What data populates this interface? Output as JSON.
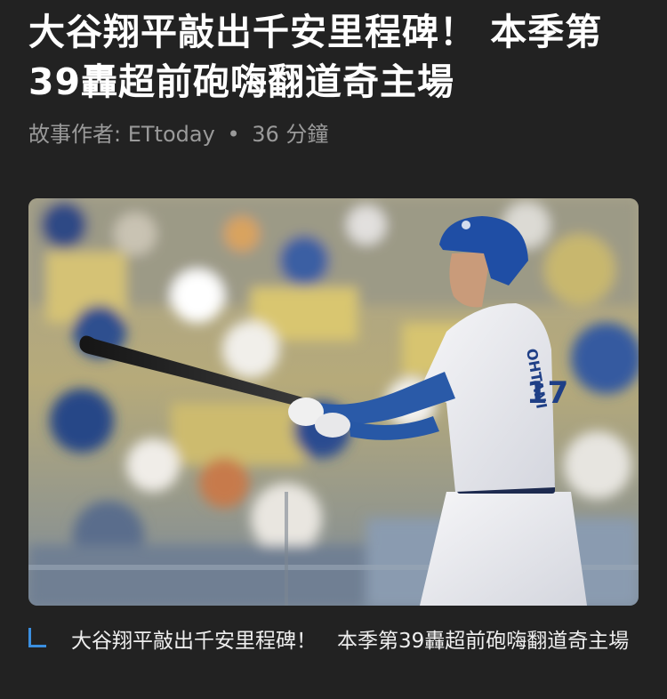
{
  "article": {
    "title": "大谷翔平敲出千安里程碑！ 本季第39轟超前砲嗨翻道奇主場",
    "byline": {
      "prefix": "故事作者:",
      "author": "ETtoday",
      "separator": "•",
      "read_time": "36 分鐘"
    },
    "image": {
      "subject": "baseball player batting in stadium",
      "jersey_text": "OHTANI",
      "jersey_number": "17"
    },
    "caption": "大谷翔平敲出千安里程碑！　本季第39轟超前砲嗨翻道奇主場"
  },
  "colors": {
    "background": "#222222",
    "title": "#ffffff",
    "byline": "#9a9a9a",
    "caption_accent": "#3b8fe0",
    "dodger_blue": "#2a5aa8"
  }
}
